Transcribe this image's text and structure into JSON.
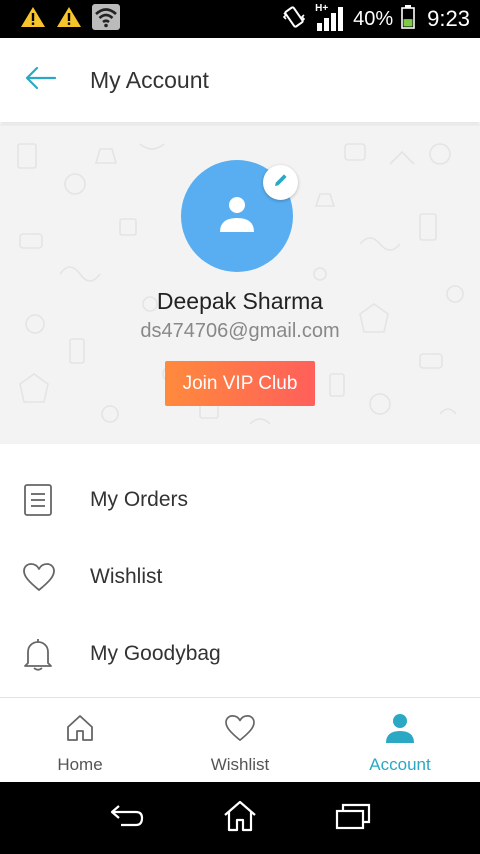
{
  "status_bar": {
    "icons": [
      "warning-icon",
      "warning-icon",
      "wifi-icon",
      "vibrate-icon",
      "signal-icon",
      "battery-icon"
    ],
    "network_label": "H+",
    "battery_percent": "40%",
    "battery_level": 0.4,
    "time": "9:23"
  },
  "app_bar": {
    "title": "My Account",
    "back_icon": "arrow-left-icon"
  },
  "profile": {
    "name": "Deepak Sharma",
    "email": "ds474706@gmail.com",
    "vip_button": "Join VIP Club",
    "avatar_icon": "person-icon",
    "edit_icon": "pencil-icon"
  },
  "menu": [
    {
      "label": "My Orders",
      "icon": "document-icon"
    },
    {
      "label": "Wishlist",
      "icon": "heart-icon"
    },
    {
      "label": "My Goodybag",
      "icon": "bell-icon"
    }
  ],
  "bottom_nav": [
    {
      "label": "Home",
      "icon": "home-icon",
      "active": false
    },
    {
      "label": "Wishlist",
      "icon": "heart-icon",
      "active": false
    },
    {
      "label": "Account",
      "icon": "person-icon",
      "active": true
    }
  ],
  "system_nav": [
    "back-icon",
    "home-icon",
    "recents-icon"
  ],
  "colors": {
    "accent": "#2aa8c4",
    "avatar": "#58aef0",
    "vip_gradient_start": "#ff8a3c",
    "vip_gradient_end": "#ff5f5a",
    "warning": "#f7c52b",
    "battery": "#7ec84a"
  }
}
